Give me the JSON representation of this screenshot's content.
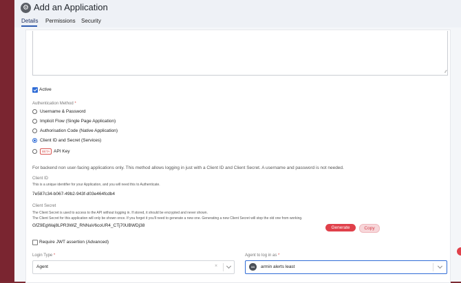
{
  "header": {
    "title": "Add an Application",
    "tabs": [
      {
        "label": "Details",
        "active": true
      },
      {
        "label": "Permissions",
        "active": false
      },
      {
        "label": "Security",
        "active": false
      }
    ]
  },
  "form": {
    "active_label": "Active",
    "active_checked": true,
    "auth_method_label": "Authentication Method",
    "required_mark": "*",
    "auth_options": [
      {
        "label": "Username & Password",
        "selected": false
      },
      {
        "label": "Implicit Flow (Single Page Application)",
        "selected": false
      },
      {
        "label": "Authorisation Code (Native Application)",
        "selected": false
      },
      {
        "label": "Client ID and Secret (Services)",
        "selected": true
      },
      {
        "label": "API Key",
        "selected": false,
        "badge": "BETA"
      }
    ],
    "auth_description": "For backend non user-facing applications only. This method allows logging in just with a Client ID and Client Secret. A username and password is not needed.",
    "client_id": {
      "label": "Client ID",
      "help": "This is a unique identifier for your Application, and you will need this to Authenticate.",
      "value": "7e587c34-b067-49b2-943f-d03e464fcdb4"
    },
    "client_secret": {
      "label": "Client Secret",
      "help_1": "The Client Secret is used to access to the API without logging in. If stored, it should be encrypted and never shown.",
      "help_2": "The Client Secret for this application will only be shown once. If you forget it you'll need to generate a new one. Generating a new Client Secret will stop the old one from working.",
      "value": "GfZ9EgWaj8LPR3WlZ_RNNaV6coUR4_CTj70UBWDj38",
      "generate_label": "Generate",
      "copy_label": "Copy"
    },
    "jwt_label": "Require JWT assertion (Advanced)",
    "jwt_checked": false,
    "login_type": {
      "label": "Login Type",
      "value": "Agent",
      "clear_glyph": "×"
    },
    "agent": {
      "label": "Agent to log in as",
      "avatar_initials": "aa",
      "value": "armin alerts least"
    }
  },
  "colors": {
    "accent": "#2e6bd6",
    "danger": "#e0404a",
    "sidebar": "#7a2530"
  }
}
